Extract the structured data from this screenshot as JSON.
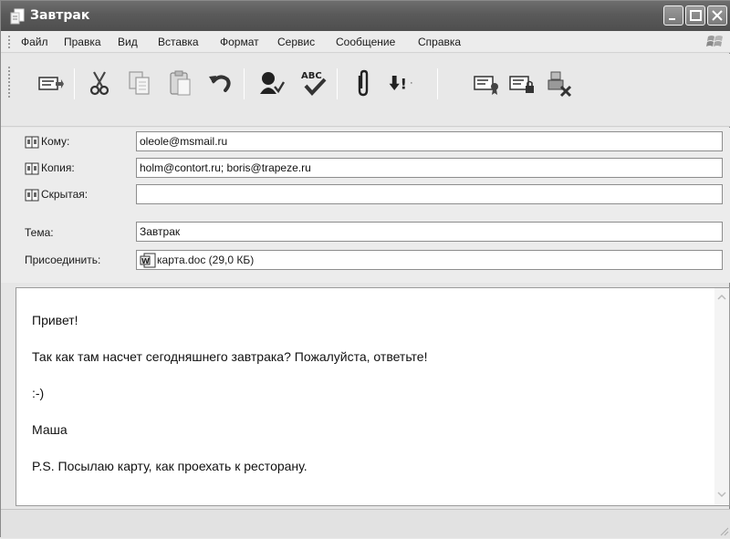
{
  "window": {
    "title": "Завтрак"
  },
  "menu": [
    {
      "label": "Файл"
    },
    {
      "label": "Правка"
    },
    {
      "label": "Вид"
    },
    {
      "label": "Вставка"
    },
    {
      "label": "Формат"
    },
    {
      "label": "Сервис"
    },
    {
      "label": "Сообщение"
    },
    {
      "label": "Справка"
    }
  ],
  "toolbar": {
    "icons": [
      "send-icon",
      "cut-icon",
      "copy-icon",
      "paste-icon",
      "undo-icon",
      "check-names-icon",
      "spelling-icon",
      "attach-icon",
      "priority-icon",
      "sign-icon",
      "encrypt-icon",
      "work-offline-icon"
    ],
    "priority_arrow": "·",
    "spelling_abc": "ABC",
    "priority_mark": "!"
  },
  "fields": {
    "to_label": "Кому:",
    "to_value": "oleole@msmail.ru",
    "cc_label": "Копия:",
    "cc_value": "holm@contort.ru; boris@trapeze.ru",
    "bcc_label": "Скрытая:",
    "bcc_value": "",
    "subject_label": "Тема:",
    "subject_value": "Завтрак",
    "attach_label": "Присоединить:",
    "attach_value": "карта.doc (29,0 КБ)"
  },
  "body": {
    "lines": [
      "Привет!",
      "Так как там насчет сегодняшнего завтрака? Пожалуйста, ответьте!",
      ":-)",
      "Маша",
      "P.S. Посылаю карту, как проехать к ресторану."
    ]
  }
}
